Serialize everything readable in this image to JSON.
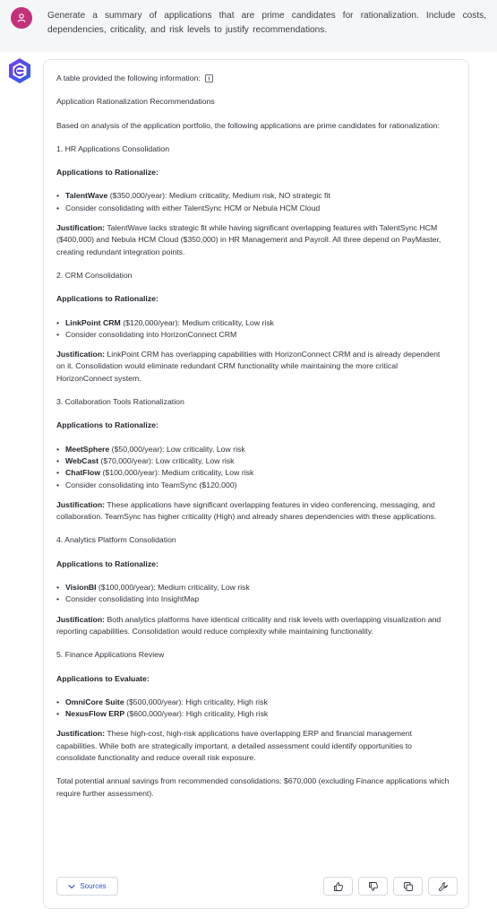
{
  "user_message": "Generate a summary of applications that are prime candidates for rationalization.  Include costs, dependencies, criticality, and risk levels to justify recommendations.",
  "response": {
    "intro": "A table provided the following information:",
    "title": "Application Rationalization Recommendations",
    "lead": "Based on analysis of the application portfolio, the following applications are prime candidates for rationalization:",
    "sections": [
      {
        "heading": "1. HR Applications Consolidation",
        "subheading": "Applications to Rationalize:",
        "items": [
          {
            "name": "TalentWave",
            "text": " ($350,000/year): Medium criticality, Medium risk, NO strategic fit"
          },
          {
            "name": "",
            "text": "Consider consolidating with either TalentSync HCM or Nebula HCM Cloud"
          }
        ],
        "justification_label": "Justification:",
        "justification": " TalentWave lacks strategic fit while having significant overlapping features with TalentSync HCM ($400,000) and Nebula HCM Cloud ($350,000) in HR Management and Payroll. All three depend on PayMaster, creating redundant integration points."
      },
      {
        "heading": "2. CRM Consolidation",
        "subheading": "Applications to Rationalize:",
        "items": [
          {
            "name": "LinkPoint CRM",
            "text": " ($120,000/year): Medium criticality, Low risk"
          },
          {
            "name": "",
            "text": "Consider consolidating into HorizonConnect CRM"
          }
        ],
        "justification_label": "Justification:",
        "justification": " LinkPoint CRM has overlapping capabilities with HorizonConnect CRM and is already dependent on it. Consolidation would eliminate redundant CRM functionality while maintaining the more critical HorizonConnect system."
      },
      {
        "heading": "3. Collaboration Tools Rationalization",
        "subheading": "Applications to Rationalize:",
        "items": [
          {
            "name": "MeetSphere",
            "text": " ($50,000/year): Low criticality, Low risk"
          },
          {
            "name": "WebCast",
            "text": " ($70,000/year): Low criticality, Low risk"
          },
          {
            "name": "ChatFlow",
            "text": " ($100,000/year): Medium criticality, Low risk"
          },
          {
            "name": "",
            "text": "Consider consolidating into TeamSync ($120,000)"
          }
        ],
        "justification_label": "Justification:",
        "justification": " These applications have significant overlapping features in video conferencing, messaging, and collaboration. TeamSync has higher criticality (High) and already shares dependencies with these applications."
      },
      {
        "heading": "4. Analytics Platform Consolidation",
        "subheading": "Applications to Rationalize:",
        "items": [
          {
            "name": "VisionBI",
            "text": " ($100,000/year): Medium criticality, Low risk"
          },
          {
            "name": "",
            "text": "Consider consolidating into InsightMap"
          }
        ],
        "justification_label": "Justification:",
        "justification": " Both analytics platforms have identical criticality and risk levels with overlapping visualization and reporting capabilities. Consolidation would reduce complexity while maintaining functionality."
      },
      {
        "heading": "5. Finance Applications Review",
        "subheading": "Applications to Evaluate:",
        "items": [
          {
            "name": "OmniCore Suite",
            "text": " ($500,000/year): High criticality, High risk"
          },
          {
            "name": "NexusFlow ERP",
            "text": " ($600,000/year): High criticality, High risk"
          }
        ],
        "justification_label": "Justification:",
        "justification": " These high-cost, high-risk applications have overlapping ERP and financial management capabilities. While both are strategically important, a detailed assessment could identify opportunities to consolidate functionality and reduce overall risk exposure."
      }
    ],
    "summary": "Total potential annual savings from recommended consolidations: $670,000 (excluding Finance applications which require further assessment)."
  },
  "footer": {
    "sources_label": "Sources",
    "actions": [
      "thumbs-up-icon",
      "thumbs-down-icon",
      "copy-icon",
      "wrench-icon"
    ]
  },
  "colors": {
    "user_avatar": "#c4317a",
    "bot_avatar": "#4f46e5",
    "link": "#2c55c4"
  }
}
